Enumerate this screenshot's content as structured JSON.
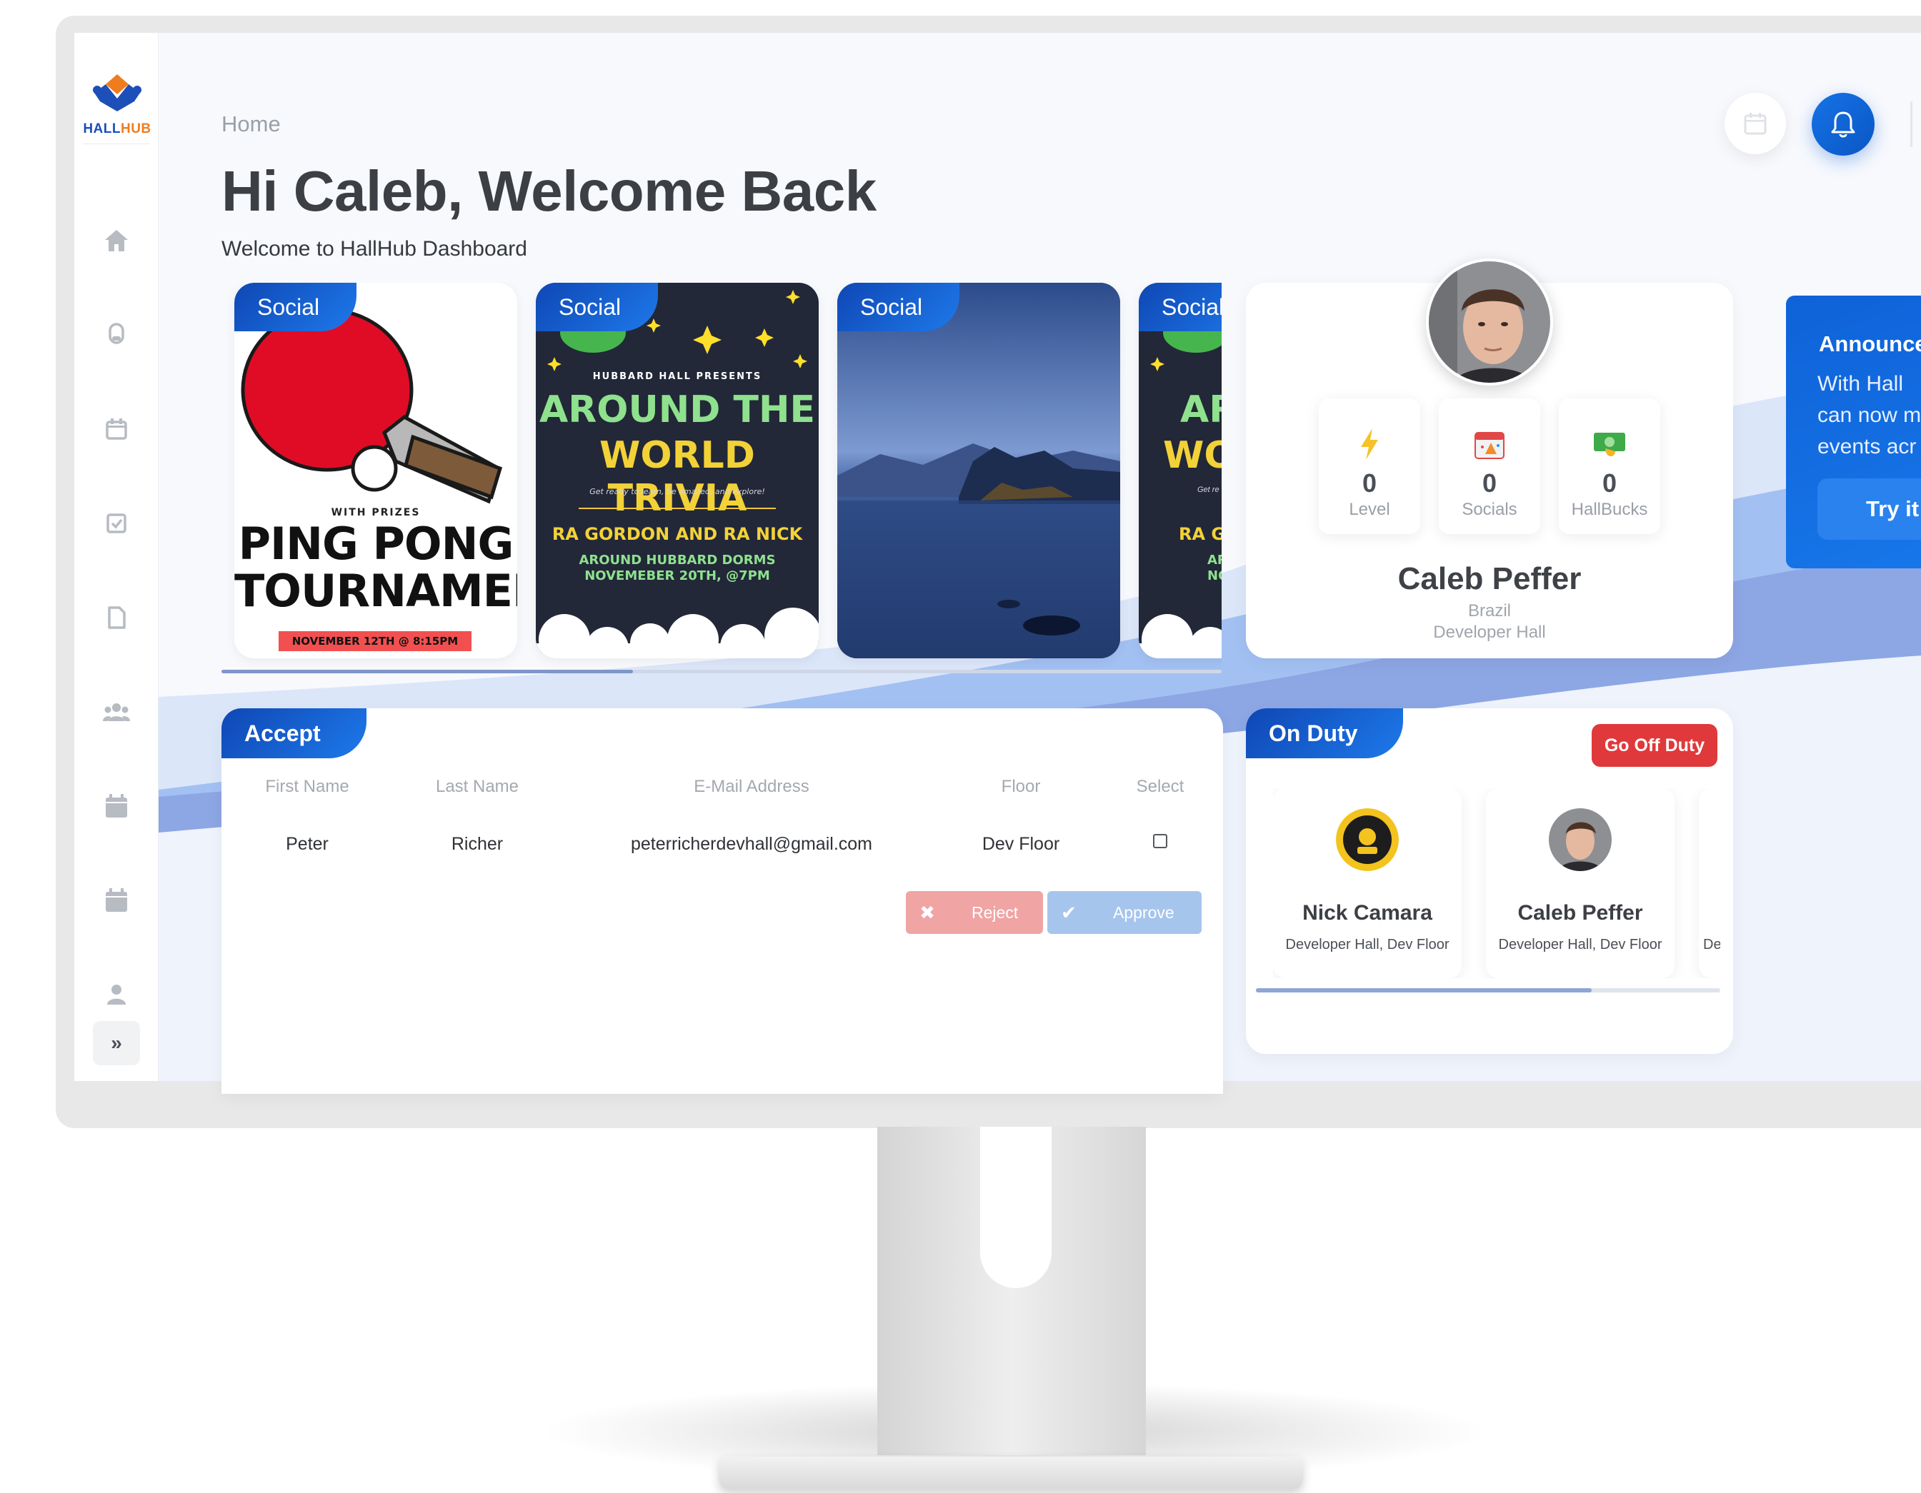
{
  "app": {
    "logo_text_a": "HALL",
    "logo_text_b": "HUB"
  },
  "header": {
    "breadcrumb": "Home",
    "greeting": "Hi Caleb, Welcome Back",
    "subtitle": "Welcome to HallHub Dashboard"
  },
  "sidebar": {
    "items": [
      {
        "icon": "home-icon"
      },
      {
        "icon": "mic-icon"
      },
      {
        "icon": "calendar-event-icon"
      },
      {
        "icon": "checklist-icon"
      },
      {
        "icon": "document-icon"
      },
      {
        "icon": "group-icon"
      },
      {
        "icon": "calendar-icon"
      },
      {
        "icon": "calendar-alt-icon"
      },
      {
        "icon": "user-icon"
      }
    ],
    "expand_label": "»"
  },
  "events": [
    {
      "tag": "Social",
      "pre": "WITH PRIZES",
      "title_line1": "PING PONG",
      "title_line2": "TOURNAMENT",
      "date": "NOVEMBER 12TH @ 8:15PM"
    },
    {
      "tag": "Social",
      "pre": "HUBBARD HALL PRESENTS",
      "title_line1": "AROUND THE",
      "title_line2": "WORLD TRIVIA",
      "tagline": "Get ready to learn, be amazed, and explore!",
      "hosts": "RA GORDON AND RA NICK",
      "where": "AROUND HUBBARD DORMS",
      "when": "NOVEMEBER 20TH, @7PM"
    },
    {
      "tag": "Social"
    },
    {
      "tag": "Social",
      "title_line1": "AR",
      "title_line2": "WO",
      "hosts": "RA G",
      "where": "AR",
      "when": "NO",
      "tagline": "Get re"
    }
  ],
  "profile": {
    "name": "Caleb Peffer",
    "country": "Brazil",
    "hall": "Developer Hall",
    "stats": [
      {
        "value": "0",
        "label": "Level",
        "icon": "lightning-icon"
      },
      {
        "value": "0",
        "label": "Socials",
        "icon": "calendar-party-icon"
      },
      {
        "value": "0",
        "label": "HallBucks",
        "icon": "money-icon"
      }
    ]
  },
  "announcement": {
    "title": "Announce",
    "line1": "With Hall",
    "line2": "can now m",
    "line3": "events acr",
    "button": "Try it"
  },
  "accept": {
    "title": "Accept",
    "columns": [
      "First Name",
      "Last Name",
      "E-Mail Address",
      "Floor",
      "Select"
    ],
    "rows": [
      {
        "first": "Peter",
        "last": "Richer",
        "email": "peterricherdevhall@gmail.com",
        "floor": "Dev Floor"
      }
    ],
    "reject_label": "Reject",
    "approve_label": "Approve"
  },
  "duty": {
    "title": "On Duty",
    "go_off_label": "Go Off Duty",
    "people": [
      {
        "name": "Nick Camara",
        "sub": "Developer Hall, Dev Floor"
      },
      {
        "name": "Caleb Peffer",
        "sub": "Developer Hall, Dev Floor"
      },
      {
        "name": "",
        "sub": "De"
      }
    ]
  },
  "colors": {
    "brand_blue": "#1565d8",
    "danger_red": "#e0393b",
    "reject_red": "#f0a4a4",
    "approve_blue": "#a6c5ec"
  }
}
